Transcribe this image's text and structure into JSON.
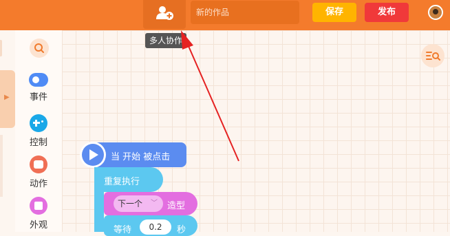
{
  "header": {
    "title_placeholder": "新的作品",
    "save_label": "保存",
    "publish_label": "发布",
    "collab_icon": "user-add-icon",
    "avatar_icon": "user-avatar-icon"
  },
  "tooltip": {
    "text": "多人协作"
  },
  "palette": {
    "search_icon": "search-icon",
    "categories": [
      {
        "label": "事件",
        "color": "#4f8bf5"
      },
      {
        "label": "控制",
        "color": "#1aa8e8"
      },
      {
        "label": "动作",
        "color": "#f06f55"
      },
      {
        "label": "外观",
        "color": "#e36ee0"
      }
    ]
  },
  "canvas": {
    "search_tool_icon": "list-search-icon"
  },
  "blocks": {
    "hat_label": "当 开始 被点击",
    "loop_label": "重复执行",
    "costume_select": "下一个",
    "costume_label": "造型",
    "wait_label": "等待",
    "wait_value": "0.2",
    "wait_unit": "秒"
  },
  "colors": {
    "brand": "#f47b2c",
    "save": "#ffb400",
    "publish": "#f0393a",
    "annotation_arrow": "#e52222"
  }
}
